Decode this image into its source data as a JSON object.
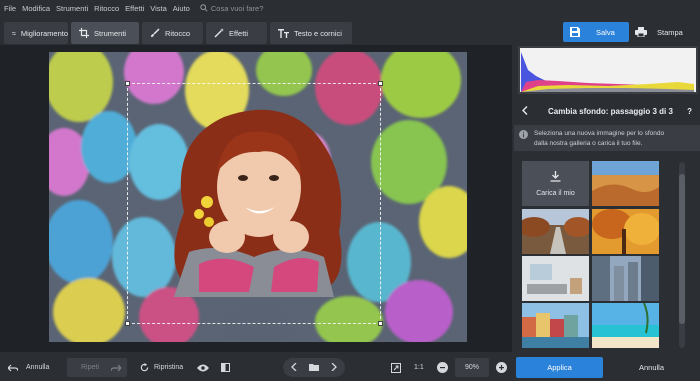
{
  "menu": {
    "items": [
      "File",
      "Modifica",
      "Strumenti",
      "Ritocco",
      "Effetti",
      "Vista",
      "Aiuto"
    ],
    "search_placeholder": "Cosa vuoi fare?"
  },
  "tabs": [
    {
      "label": "Miglioramento",
      "icon": "sliders-icon"
    },
    {
      "label": "Strumenti",
      "icon": "crop-icon"
    },
    {
      "label": "Ritocco",
      "icon": "brush-icon"
    },
    {
      "label": "Effetti",
      "icon": "magic-wand-icon"
    },
    {
      "label": "Testo e cornici",
      "icon": "text-icon"
    }
  ],
  "toolbar": {
    "save_label": "Salva",
    "print_label": "Stampa"
  },
  "panel": {
    "step_title": "Cambia sfondo: passaggio 3 di 3",
    "help": "?",
    "info_line1": "Seleziona una nuova immagine per lo sfondo",
    "info_line2": "dalla nostra galleria o carica il tuo file.",
    "upload_label": "Carica il mio"
  },
  "bottom": {
    "undo_label": "Annulla",
    "redo_label": "Ripeti",
    "reset_label": "Ripristina",
    "ratio_label": "1:1",
    "zoom_value": "90%"
  },
  "actions": {
    "apply_label": "Applica",
    "cancel_label": "Annulla"
  },
  "colors": {
    "accent": "#2a82da",
    "active_tab": "#4b4f57"
  }
}
